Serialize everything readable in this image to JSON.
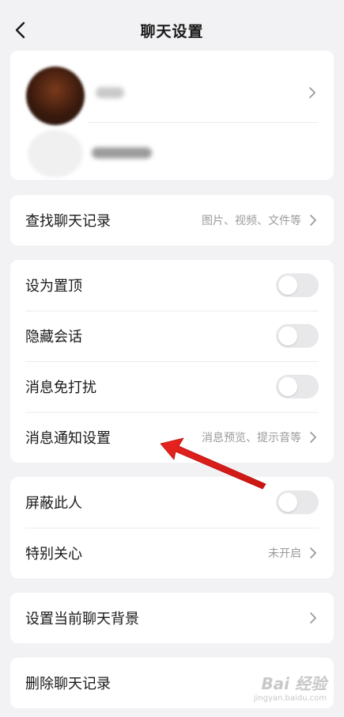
{
  "header": {
    "title": "聊天设置"
  },
  "search_card": {
    "label": "查找聊天记录",
    "hint": "图片、视频、文件等"
  },
  "settings_card": {
    "pin_label": "设为置顶",
    "hide_label": "隐藏会话",
    "dnd_label": "消息免打扰",
    "notify_label": "消息通知设置",
    "notify_hint": "消息预览、提示音等"
  },
  "relation_card": {
    "block_label": "屏蔽此人",
    "care_label": "特别关心",
    "care_hint": "未开启"
  },
  "background_card": {
    "label": "设置当前聊天背景"
  },
  "delete_card": {
    "label": "删除聊天记录"
  },
  "colors": {
    "accent_arrow": "#e8231f",
    "background": "#f2f2f5",
    "toggle_off": "#e8e8ea"
  },
  "watermark": {
    "main": "Bai 经验",
    "sub": "jingyan.baidu.com"
  }
}
